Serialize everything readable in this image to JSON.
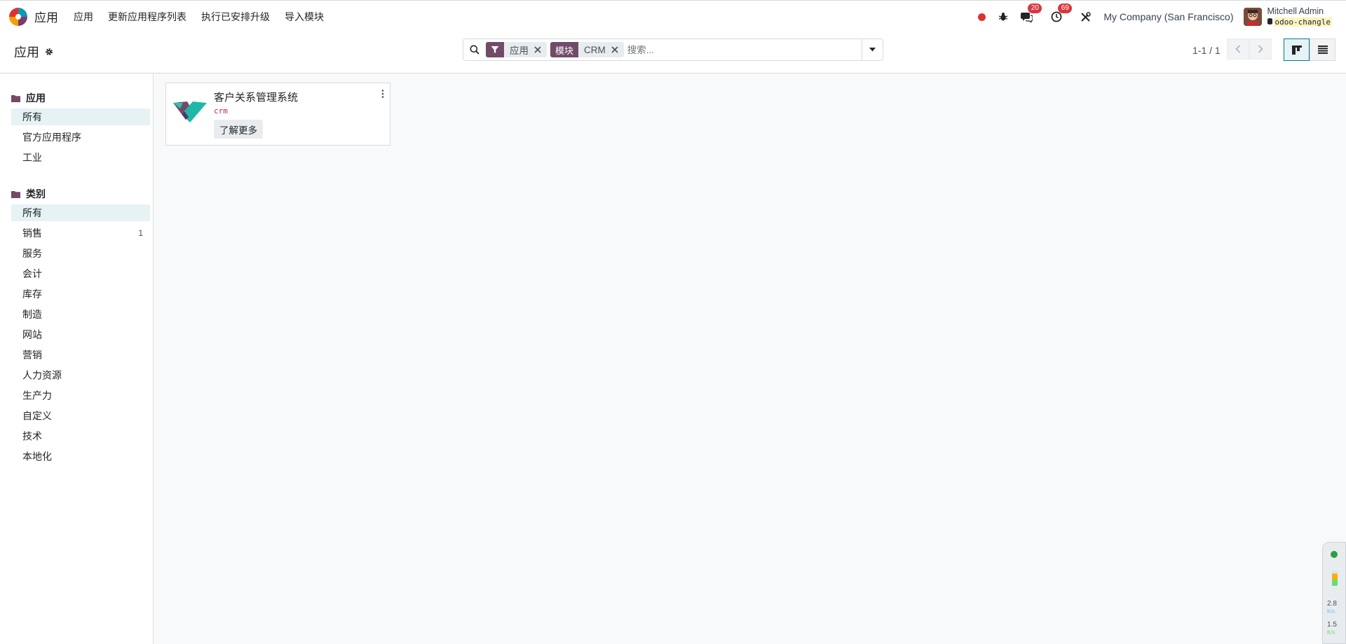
{
  "navbar": {
    "app_title": "应用",
    "menu": [
      "应用",
      "更新应用程序列表",
      "执行已安排升级",
      "导入模块"
    ],
    "messages_count": "20",
    "activities_count": "69",
    "company": "My Company (San Francisco)",
    "user_name": "Mitchell Admin",
    "database": "odoo-changle",
    "icons": [
      "app-logo-icon",
      "record-dot-icon",
      "bug-icon",
      "chat-icon",
      "clock-icon",
      "tools-icon",
      "database-icon"
    ]
  },
  "control_panel": {
    "breadcrumb": "应用",
    "facets": [
      {
        "label": "",
        "value": "应用",
        "icon": "filter-icon"
      },
      {
        "label": "模块",
        "value": "CRM"
      }
    ],
    "search_placeholder": "搜索...",
    "pager": "1-1 / 1",
    "views": [
      "kanban",
      "list"
    ],
    "active_view": "kanban"
  },
  "sidebar": {
    "sections": [
      {
        "title": "应用",
        "items": [
          {
            "label": "所有",
            "count": ""
          },
          {
            "label": "官方应用程序",
            "count": ""
          },
          {
            "label": "工业",
            "count": ""
          }
        ]
      },
      {
        "title": "类别",
        "items": [
          {
            "label": "所有",
            "count": ""
          },
          {
            "label": "销售",
            "count": "1"
          },
          {
            "label": "服务",
            "count": ""
          },
          {
            "label": "会计",
            "count": ""
          },
          {
            "label": "库存",
            "count": ""
          },
          {
            "label": "制造",
            "count": ""
          },
          {
            "label": "网站",
            "count": ""
          },
          {
            "label": "营销",
            "count": ""
          },
          {
            "label": "人力资源",
            "count": ""
          },
          {
            "label": "生产力",
            "count": ""
          },
          {
            "label": "自定义",
            "count": ""
          },
          {
            "label": "技术",
            "count": ""
          },
          {
            "label": "本地化",
            "count": ""
          }
        ]
      }
    ]
  },
  "cards": [
    {
      "title": "客户关系管理系统",
      "technical_name": "crm",
      "button": "了解更多",
      "icon": "crm-handshake-icon"
    }
  ],
  "monitor": {
    "up": "2.8",
    "up_unit": "K/s",
    "down": "1.5",
    "down_unit": "K/s"
  },
  "colors": {
    "brand": "#714b67",
    "accent": "#017e84",
    "badge": "#d9363e",
    "selected_bg": "#e6f2f3"
  }
}
